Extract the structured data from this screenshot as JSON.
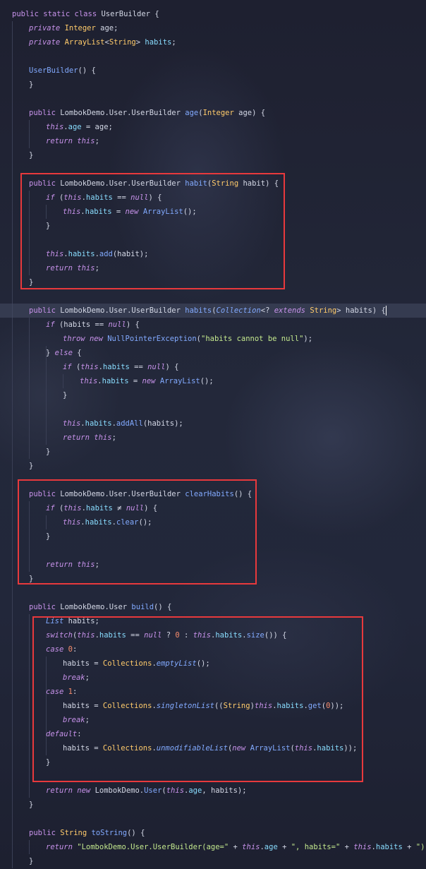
{
  "editor": {
    "lines": [
      {
        "indent": 0,
        "tokens": [
          [
            "kwn",
            "public "
          ],
          [
            "kwn",
            "static "
          ],
          [
            "kwn",
            "class "
          ],
          [
            "pl",
            "UserBuilder {"
          ]
        ]
      },
      {
        "indent": 1,
        "tokens": [
          [
            "kw",
            "private "
          ],
          [
            "ty",
            "Integer "
          ],
          [
            "pl",
            "age;"
          ]
        ]
      },
      {
        "indent": 1,
        "tokens": [
          [
            "kw",
            "private "
          ],
          [
            "ty",
            "ArrayList"
          ],
          [
            "pl",
            "<"
          ],
          [
            "ty",
            "String"
          ],
          [
            "pl",
            "> "
          ],
          [
            "fld",
            "habits"
          ],
          [
            "pl",
            ";"
          ]
        ]
      },
      {
        "indent": 0,
        "tokens": []
      },
      {
        "indent": 1,
        "tokens": [
          [
            "fn",
            "UserBuilder"
          ],
          [
            "pl",
            "() {"
          ]
        ]
      },
      {
        "indent": 1,
        "tokens": [
          [
            "pl",
            "}"
          ]
        ]
      },
      {
        "indent": 0,
        "tokens": []
      },
      {
        "indent": 1,
        "tokens": [
          [
            "kwn",
            "public "
          ],
          [
            "pl",
            "LombokDemo.User.UserBuilder "
          ],
          [
            "fn",
            "age"
          ],
          [
            "pl",
            "("
          ],
          [
            "ty",
            "Integer "
          ],
          [
            "pl",
            "age) {"
          ]
        ]
      },
      {
        "indent": 2,
        "tokens": [
          [
            "kw",
            "this"
          ],
          [
            "pl",
            "."
          ],
          [
            "fld",
            "age"
          ],
          [
            "pl",
            " = age;"
          ]
        ]
      },
      {
        "indent": 2,
        "tokens": [
          [
            "kw",
            "return "
          ],
          [
            "kw",
            "this"
          ],
          [
            "pl",
            ";"
          ]
        ]
      },
      {
        "indent": 1,
        "tokens": [
          [
            "pl",
            "}"
          ]
        ]
      },
      {
        "indent": 0,
        "tokens": []
      },
      {
        "indent": 1,
        "tokens": [
          [
            "kwn",
            "public "
          ],
          [
            "pl",
            "LombokDemo.User.UserBuilder "
          ],
          [
            "fn",
            "habit"
          ],
          [
            "pl",
            "("
          ],
          [
            "ty",
            "String "
          ],
          [
            "pl",
            "habit) {"
          ]
        ]
      },
      {
        "indent": 2,
        "tokens": [
          [
            "kw",
            "if "
          ],
          [
            "pl",
            "("
          ],
          [
            "kw",
            "this"
          ],
          [
            "pl",
            "."
          ],
          [
            "fld",
            "habits"
          ],
          [
            "pl",
            " == "
          ],
          [
            "kw",
            "null"
          ],
          [
            "pl",
            ") {"
          ]
        ]
      },
      {
        "indent": 3,
        "tokens": [
          [
            "kw",
            "this"
          ],
          [
            "pl",
            "."
          ],
          [
            "fld",
            "habits"
          ],
          [
            "pl",
            " = "
          ],
          [
            "kw",
            "new "
          ],
          [
            "fn",
            "ArrayList"
          ],
          [
            "pl",
            "();"
          ]
        ]
      },
      {
        "indent": 2,
        "tokens": [
          [
            "pl",
            "}"
          ]
        ]
      },
      {
        "indent": 0,
        "tokens": []
      },
      {
        "indent": 2,
        "tokens": [
          [
            "kw",
            "this"
          ],
          [
            "pl",
            "."
          ],
          [
            "fld",
            "habits"
          ],
          [
            "pl",
            "."
          ],
          [
            "fn",
            "add"
          ],
          [
            "pl",
            "(habit);"
          ]
        ]
      },
      {
        "indent": 2,
        "tokens": [
          [
            "kw",
            "return "
          ],
          [
            "kw",
            "this"
          ],
          [
            "pl",
            ";"
          ]
        ]
      },
      {
        "indent": 1,
        "tokens": [
          [
            "pl",
            "}"
          ]
        ]
      },
      {
        "indent": 0,
        "tokens": []
      },
      {
        "indent": 1,
        "hl": true,
        "caret": true,
        "tokens": [
          [
            "kwn",
            "public "
          ],
          [
            "pl",
            "LombokDemo.User.UserBuilder "
          ],
          [
            "fn",
            "habits"
          ],
          [
            "pl",
            "("
          ],
          [
            "it",
            "Collection"
          ],
          [
            "pl",
            "<? "
          ],
          [
            "kw",
            "extends "
          ],
          [
            "ty",
            "String"
          ],
          [
            "pl",
            "> habits) "
          ]
        ]
      },
      {
        "indent": 2,
        "tokens": [
          [
            "kw",
            "if "
          ],
          [
            "pl",
            "(habits == "
          ],
          [
            "kw",
            "null"
          ],
          [
            "pl",
            ") {"
          ]
        ]
      },
      {
        "indent": 3,
        "tokens": [
          [
            "kw",
            "throw "
          ],
          [
            "kw",
            "new "
          ],
          [
            "fn",
            "NullPointerException"
          ],
          [
            "pl",
            "("
          ],
          [
            "st",
            "\"habits cannot be null\""
          ],
          [
            "pl",
            ");"
          ]
        ]
      },
      {
        "indent": 2,
        "tokens": [
          [
            "pl",
            "} "
          ],
          [
            "kw",
            "else "
          ],
          [
            "pl",
            "{"
          ]
        ]
      },
      {
        "indent": 3,
        "tokens": [
          [
            "kw",
            "if "
          ],
          [
            "pl",
            "("
          ],
          [
            "kw",
            "this"
          ],
          [
            "pl",
            "."
          ],
          [
            "fld",
            "habits"
          ],
          [
            "pl",
            " == "
          ],
          [
            "kw",
            "null"
          ],
          [
            "pl",
            ") {"
          ]
        ]
      },
      {
        "indent": 4,
        "tokens": [
          [
            "kw",
            "this"
          ],
          [
            "pl",
            "."
          ],
          [
            "fld",
            "habits"
          ],
          [
            "pl",
            " = "
          ],
          [
            "kw",
            "new "
          ],
          [
            "fn",
            "ArrayList"
          ],
          [
            "pl",
            "();"
          ]
        ]
      },
      {
        "indent": 3,
        "tokens": [
          [
            "pl",
            "}"
          ]
        ]
      },
      {
        "indent": 0,
        "tokens": []
      },
      {
        "indent": 3,
        "tokens": [
          [
            "kw",
            "this"
          ],
          [
            "pl",
            "."
          ],
          [
            "fld",
            "habits"
          ],
          [
            "pl",
            "."
          ],
          [
            "fn",
            "addAll"
          ],
          [
            "pl",
            "(habits);"
          ]
        ]
      },
      {
        "indent": 3,
        "tokens": [
          [
            "kw",
            "return "
          ],
          [
            "kw",
            "this"
          ],
          [
            "pl",
            ";"
          ]
        ]
      },
      {
        "indent": 2,
        "tokens": [
          [
            "pl",
            "}"
          ]
        ]
      },
      {
        "indent": 1,
        "tokens": [
          [
            "pl",
            "}"
          ]
        ]
      },
      {
        "indent": 0,
        "tokens": []
      },
      {
        "indent": 1,
        "tokens": [
          [
            "kwn",
            "public "
          ],
          [
            "pl",
            "LombokDemo.User.UserBuilder "
          ],
          [
            "fn",
            "clearHabits"
          ],
          [
            "pl",
            "() {"
          ]
        ]
      },
      {
        "indent": 2,
        "tokens": [
          [
            "kw",
            "if "
          ],
          [
            "pl",
            "("
          ],
          [
            "kw",
            "this"
          ],
          [
            "pl",
            "."
          ],
          [
            "fld",
            "habits"
          ],
          [
            "pl",
            " ≠ "
          ],
          [
            "kw",
            "null"
          ],
          [
            "pl",
            ") {"
          ]
        ]
      },
      {
        "indent": 3,
        "tokens": [
          [
            "kw",
            "this"
          ],
          [
            "pl",
            "."
          ],
          [
            "fld",
            "habits"
          ],
          [
            "pl",
            "."
          ],
          [
            "fn",
            "clear"
          ],
          [
            "pl",
            "();"
          ]
        ]
      },
      {
        "indent": 2,
        "tokens": [
          [
            "pl",
            "}"
          ]
        ]
      },
      {
        "indent": 0,
        "tokens": []
      },
      {
        "indent": 2,
        "tokens": [
          [
            "kw",
            "return "
          ],
          [
            "kw",
            "this"
          ],
          [
            "pl",
            ";"
          ]
        ]
      },
      {
        "indent": 1,
        "tokens": [
          [
            "pl",
            "}"
          ]
        ]
      },
      {
        "indent": 0,
        "tokens": []
      },
      {
        "indent": 1,
        "tokens": [
          [
            "kwn",
            "public "
          ],
          [
            "pl",
            "LombokDemo.User "
          ],
          [
            "fn",
            "build"
          ],
          [
            "pl",
            "() {"
          ]
        ]
      },
      {
        "indent": 2,
        "tokens": [
          [
            "it",
            "List "
          ],
          [
            "pl",
            "habits;"
          ]
        ]
      },
      {
        "indent": 2,
        "tokens": [
          [
            "kw",
            "switch"
          ],
          [
            "pl",
            "("
          ],
          [
            "kw",
            "this"
          ],
          [
            "pl",
            "."
          ],
          [
            "fld",
            "habits"
          ],
          [
            "pl",
            " == "
          ],
          [
            "kw",
            "null"
          ],
          [
            "pl",
            " ? "
          ],
          [
            "num",
            "0"
          ],
          [
            "pl",
            " : "
          ],
          [
            "kw",
            "this"
          ],
          [
            "pl",
            "."
          ],
          [
            "fld",
            "habits"
          ],
          [
            "pl",
            "."
          ],
          [
            "fn",
            "size"
          ],
          [
            "pl",
            "()) {"
          ]
        ]
      },
      {
        "indent": 2,
        "tokens": [
          [
            "kw",
            "case "
          ],
          [
            "num",
            "0"
          ],
          [
            "pl",
            ":"
          ]
        ]
      },
      {
        "indent": 3,
        "tokens": [
          [
            "pl",
            "habits = "
          ],
          [
            "cls",
            "Collections"
          ],
          [
            "pl",
            "."
          ],
          [
            "it",
            "emptyList"
          ],
          [
            "pl",
            "();"
          ]
        ]
      },
      {
        "indent": 3,
        "tokens": [
          [
            "kw",
            "break"
          ],
          [
            "pl",
            ";"
          ]
        ]
      },
      {
        "indent": 2,
        "tokens": [
          [
            "kw",
            "case "
          ],
          [
            "num",
            "1"
          ],
          [
            "pl",
            ":"
          ]
        ]
      },
      {
        "indent": 3,
        "tokens": [
          [
            "pl",
            "habits = "
          ],
          [
            "cls",
            "Collections"
          ],
          [
            "pl",
            "."
          ],
          [
            "it",
            "singletonList"
          ],
          [
            "pl",
            "(("
          ],
          [
            "ty",
            "String"
          ],
          [
            "pl",
            ")"
          ],
          [
            "kw",
            "this"
          ],
          [
            "pl",
            "."
          ],
          [
            "fld",
            "habits"
          ],
          [
            "pl",
            "."
          ],
          [
            "fn",
            "get"
          ],
          [
            "pl",
            "("
          ],
          [
            "num",
            "0"
          ],
          [
            "pl",
            "));"
          ]
        ]
      },
      {
        "indent": 3,
        "tokens": [
          [
            "kw",
            "break"
          ],
          [
            "pl",
            ";"
          ]
        ]
      },
      {
        "indent": 2,
        "tokens": [
          [
            "kw",
            "default"
          ],
          [
            "pl",
            ":"
          ]
        ]
      },
      {
        "indent": 3,
        "tokens": [
          [
            "pl",
            "habits = "
          ],
          [
            "cls",
            "Collections"
          ],
          [
            "pl",
            "."
          ],
          [
            "it",
            "unmodifiableList"
          ],
          [
            "pl",
            "("
          ],
          [
            "kw",
            "new "
          ],
          [
            "fn",
            "ArrayList"
          ],
          [
            "pl",
            "("
          ],
          [
            "kw",
            "this"
          ],
          [
            "pl",
            "."
          ],
          [
            "fld",
            "habits"
          ],
          [
            "pl",
            "));"
          ]
        ]
      },
      {
        "indent": 2,
        "tokens": [
          [
            "pl",
            "}"
          ]
        ]
      },
      {
        "indent": 0,
        "tokens": []
      },
      {
        "indent": 2,
        "tokens": [
          [
            "kw",
            "return "
          ],
          [
            "kw",
            "new "
          ],
          [
            "pl",
            "LombokDemo."
          ],
          [
            "fn",
            "User"
          ],
          [
            "pl",
            "("
          ],
          [
            "kw",
            "this"
          ],
          [
            "pl",
            "."
          ],
          [
            "fld",
            "age"
          ],
          [
            "pl",
            ", habits);"
          ]
        ]
      },
      {
        "indent": 1,
        "tokens": [
          [
            "pl",
            "}"
          ]
        ]
      },
      {
        "indent": 0,
        "tokens": []
      },
      {
        "indent": 1,
        "tokens": [
          [
            "kwn",
            "public "
          ],
          [
            "ty",
            "String "
          ],
          [
            "fn",
            "toString"
          ],
          [
            "pl",
            "() {"
          ]
        ]
      },
      {
        "indent": 2,
        "tokens": [
          [
            "kw",
            "return "
          ],
          [
            "st",
            "\"LombokDemo.User.UserBuilder(age=\""
          ],
          [
            "pl",
            " + "
          ],
          [
            "kw",
            "this"
          ],
          [
            "pl",
            "."
          ],
          [
            "fld",
            "age"
          ],
          [
            "pl",
            " + "
          ],
          [
            "st",
            "\", habits=\""
          ],
          [
            "pl",
            " + "
          ],
          [
            "kw",
            "this"
          ],
          [
            "pl",
            "."
          ],
          [
            "fld",
            "habits"
          ],
          [
            "pl",
            " + "
          ],
          [
            "st",
            "\")\""
          ],
          [
            "pl",
            ";"
          ]
        ]
      },
      {
        "indent": 1,
        "tokens": [
          [
            "pl",
            "}"
          ]
        ]
      }
    ]
  }
}
